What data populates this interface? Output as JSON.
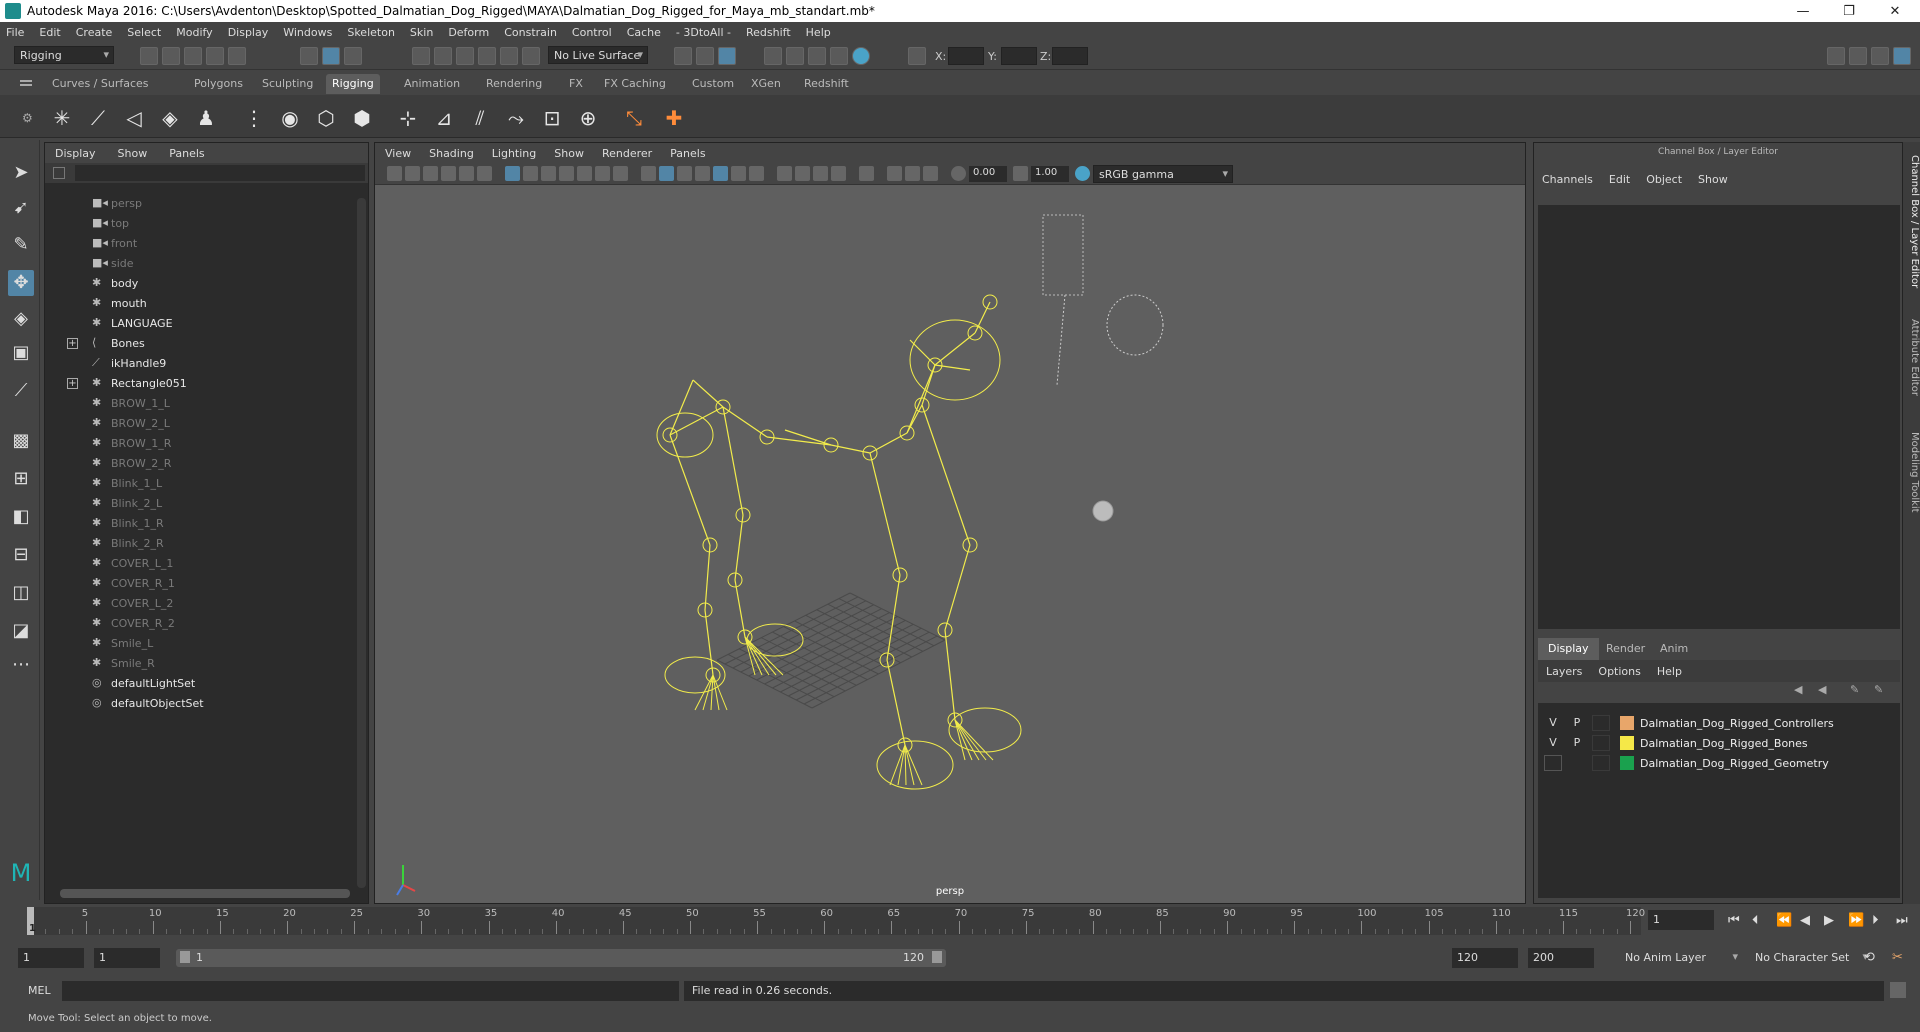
{
  "window": {
    "title": "Autodesk Maya 2016: C:\\Users\\Avdenton\\Desktop\\Spotted_Dalmatian_Dog_Rigged\\MAYA\\Dalmatian_Dog_Rigged_for_Maya_mb_standart.mb*",
    "minimize": "—",
    "maximize": "❐",
    "close": "✕"
  },
  "menubar": [
    "File",
    "Edit",
    "Create",
    "Select",
    "Modify",
    "Display",
    "Windows",
    "Skeleton",
    "Skin",
    "Deform",
    "Constrain",
    "Control",
    "Cache",
    "- 3DtoAll -",
    "Redshift",
    "Help"
  ],
  "statusline": {
    "mode": "Rigging",
    "live_surface": "No Live Surface",
    "x_label": "X:",
    "y_label": "Y:",
    "z_label": "Z:"
  },
  "shelf_tabs": [
    "Curves / Surfaces",
    "Polygons",
    "Sculpting",
    "Rigging",
    "Animation",
    "Rendering",
    "FX",
    "FX Caching",
    "Custom",
    "XGen",
    "Redshift"
  ],
  "shelf_active": "Rigging",
  "outliner": {
    "menu": [
      "Display",
      "Show",
      "Panels"
    ],
    "items": [
      {
        "label": "persp",
        "dim": true,
        "icon": "camera-icon"
      },
      {
        "label": "top",
        "dim": true,
        "icon": "camera-icon"
      },
      {
        "label": "front",
        "dim": true,
        "icon": "camera-icon"
      },
      {
        "label": "side",
        "dim": true,
        "icon": "camera-icon"
      },
      {
        "label": "body",
        "dim": false,
        "icon": "mesh-icon"
      },
      {
        "label": "mouth",
        "dim": false,
        "icon": "mesh-icon"
      },
      {
        "label": "LANGUAGE",
        "dim": false,
        "icon": "mesh-icon"
      },
      {
        "label": "Bones",
        "dim": false,
        "icon": "joint-icon",
        "expand": "+"
      },
      {
        "label": "ikHandle9",
        "dim": false,
        "icon": "ik-icon"
      },
      {
        "label": "Rectangle051",
        "dim": false,
        "icon": "curve-icon",
        "expand": "+"
      },
      {
        "label": "BROW_1_L",
        "dim": true,
        "icon": "curve-icon"
      },
      {
        "label": "BROW_2_L",
        "dim": true,
        "icon": "curve-icon"
      },
      {
        "label": "BROW_1_R",
        "dim": true,
        "icon": "curve-icon"
      },
      {
        "label": "BROW_2_R",
        "dim": true,
        "icon": "curve-icon"
      },
      {
        "label": "Blink_1_L",
        "dim": true,
        "icon": "curve-icon"
      },
      {
        "label": "Blink_2_L",
        "dim": true,
        "icon": "curve-icon"
      },
      {
        "label": "Blink_1_R",
        "dim": true,
        "icon": "curve-icon"
      },
      {
        "label": "Blink_2_R",
        "dim": true,
        "icon": "curve-icon"
      },
      {
        "label": "COVER_L_1",
        "dim": true,
        "icon": "curve-icon"
      },
      {
        "label": "COVER_R_1",
        "dim": true,
        "icon": "curve-icon"
      },
      {
        "label": "COVER_L_2",
        "dim": true,
        "icon": "curve-icon"
      },
      {
        "label": "COVER_R_2",
        "dim": true,
        "icon": "curve-icon"
      },
      {
        "label": "Smile_L",
        "dim": true,
        "icon": "curve-icon"
      },
      {
        "label": "Smile_R",
        "dim": true,
        "icon": "curve-icon"
      },
      {
        "label": "defaultLightSet",
        "dim": false,
        "icon": "set-icon"
      },
      {
        "label": "defaultObjectSet",
        "dim": false,
        "icon": "set-icon"
      }
    ]
  },
  "viewport": {
    "menu": [
      "View",
      "Shading",
      "Lighting",
      "Show",
      "Renderer",
      "Panels"
    ],
    "exposure": "0.00",
    "gamma": "1.00",
    "color_space": "sRGB gamma",
    "camera_label": "persp",
    "wire_color": "#f2ec4b"
  },
  "channelbox": {
    "title": "Channel Box / Layer Editor",
    "menu": [
      "Channels",
      "Edit",
      "Object",
      "Show"
    ],
    "layer_tabs": [
      "Display",
      "Render",
      "Anim"
    ],
    "layer_active": "Display",
    "layer_menu": [
      "Layers",
      "Options",
      "Help"
    ],
    "layers": [
      {
        "v": "V",
        "p": "P",
        "color": "#e8a66a",
        "name": "Dalmatian_Dog_Rigged_Controllers"
      },
      {
        "v": "V",
        "p": "P",
        "color": "#f5e848",
        "name": "Dalmatian_Dog_Rigged_Bones"
      },
      {
        "v": "",
        "p": "",
        "color": "#1aa14e",
        "name": "Dalmatian_Dog_Rigged_Geometry"
      }
    ]
  },
  "side_tabs": [
    "Channel Box / Layer Editor",
    "Attribute Editor",
    "Modeling Toolkit"
  ],
  "timeslider": {
    "ticks": [
      "5",
      "10",
      "15",
      "20",
      "25",
      "30",
      "35",
      "40",
      "45",
      "50",
      "55",
      "60",
      "65",
      "70",
      "75",
      "80",
      "85",
      "90",
      "95",
      "100",
      "105",
      "110",
      "115",
      "120"
    ],
    "first": "1",
    "current_frame": "1"
  },
  "range": {
    "start": "1",
    "playback_start": "1",
    "bar_start": "1",
    "bar_end": "120",
    "playback_end": "120",
    "end": "200",
    "anim_layer": "No Anim Layer",
    "char_set": "No Character Set"
  },
  "cmdline": {
    "lang": "MEL",
    "result": "File read in  0.26 seconds."
  },
  "helpline": "Move Tool: Select an object to move."
}
